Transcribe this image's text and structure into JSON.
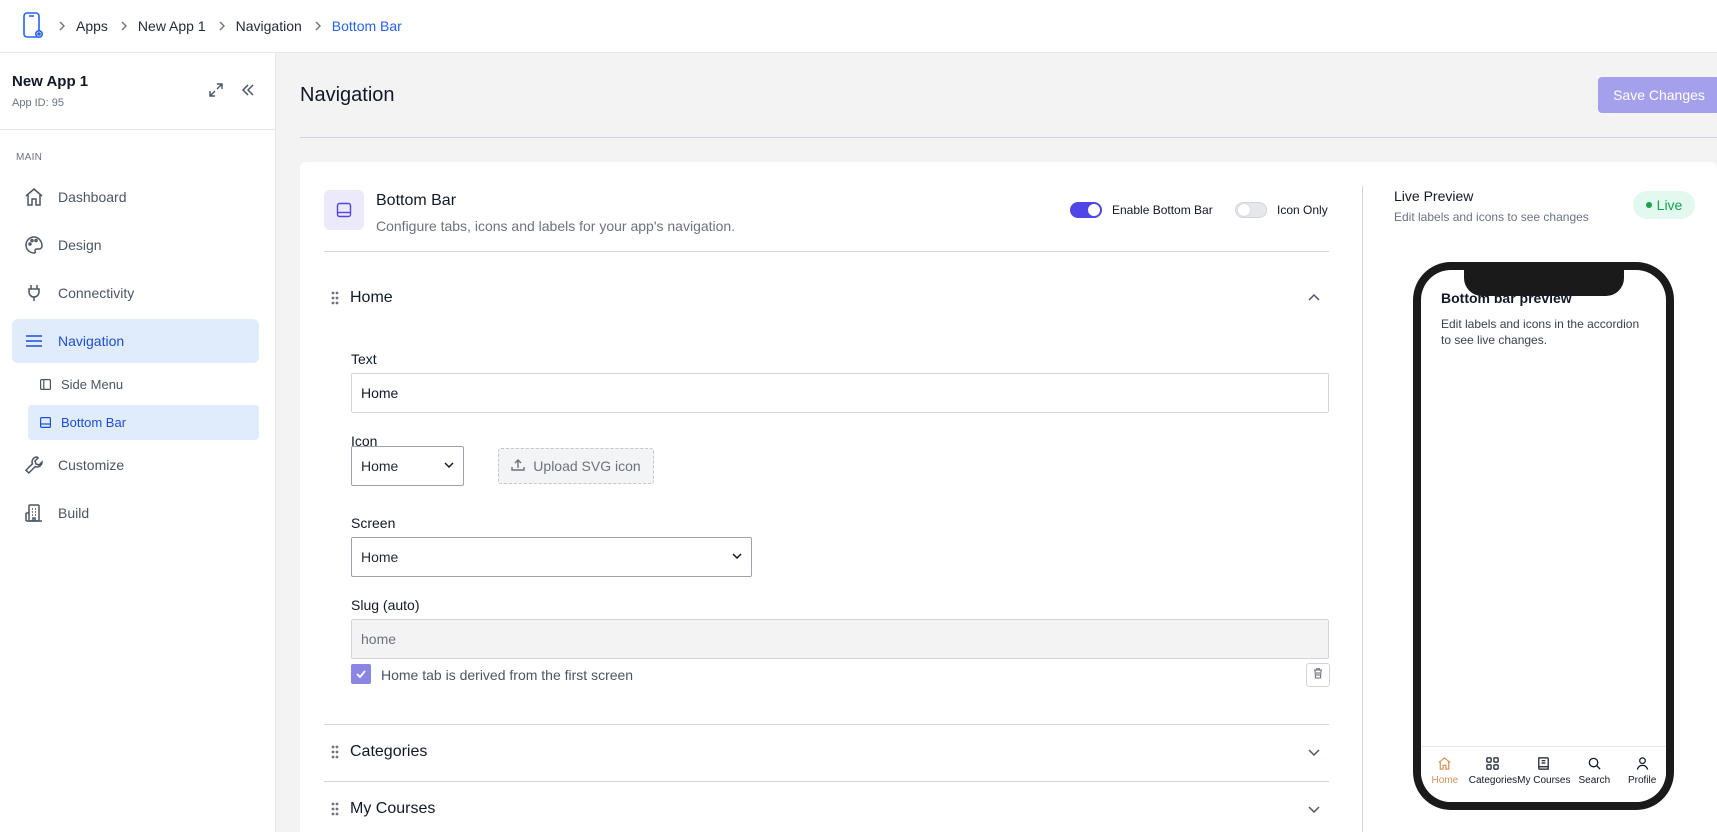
{
  "breadcrumb": [
    "Apps",
    "New App 1",
    "Navigation",
    "Bottom Bar"
  ],
  "sidebar": {
    "app_title": "New App 1",
    "app_id": "App ID: 95",
    "section_label": "MAIN",
    "items": [
      {
        "label": "Dashboard",
        "icon": "home-icon"
      },
      {
        "label": "Design",
        "icon": "palette-icon"
      },
      {
        "label": "Connectivity",
        "icon": "plug-icon"
      },
      {
        "label": "Navigation",
        "icon": "menu-icon"
      },
      {
        "label": "Customize",
        "icon": "wrench-icon"
      },
      {
        "label": "Build",
        "icon": "building-icon"
      }
    ],
    "sub_items": [
      {
        "label": "Side Menu",
        "icon": "sidebar-icon"
      },
      {
        "label": "Bottom Bar",
        "icon": "bottombar-icon"
      }
    ]
  },
  "main": {
    "title": "Navigation",
    "save_label": "Save Changes",
    "bottom_bar": {
      "title": "Bottom Bar",
      "description": "Configure tabs, icons and labels for your app's navigation.",
      "enable_label": "Enable Bottom Bar",
      "icon_only_label": "Icon Only"
    },
    "accordion": [
      {
        "title": "Home"
      },
      {
        "title": "Categories"
      },
      {
        "title": "My Courses"
      }
    ],
    "form": {
      "text_label": "Text",
      "text_value": "Home",
      "icon_label": "Icon",
      "icon_value": "Home",
      "upload_label": "Upload SVG icon",
      "screen_label": "Screen",
      "screen_value": "Home",
      "slug_label": "Slug (auto)",
      "slug_value": "home",
      "checkbox_label": "Home tab is derived from the first screen"
    }
  },
  "preview": {
    "title": "Live Preview",
    "subtitle": "Edit labels and icons to see changes",
    "badge": "Live",
    "screen_title": "Bottom bar preview",
    "screen_desc": "Edit labels and icons in the accordion to see live changes.",
    "tabs": [
      {
        "label": "Home",
        "icon": "home-icon"
      },
      {
        "label": "Categories",
        "icon": "grid-icon"
      },
      {
        "label": "My Courses",
        "icon": "book-icon"
      },
      {
        "label": "Search",
        "icon": "search-icon"
      },
      {
        "label": "Profile",
        "icon": "user-icon"
      }
    ]
  },
  "colors": {
    "accent": "#4f46e5",
    "link": "#2563eb",
    "active_tab": "#d8935d",
    "live": "#16a34a"
  }
}
